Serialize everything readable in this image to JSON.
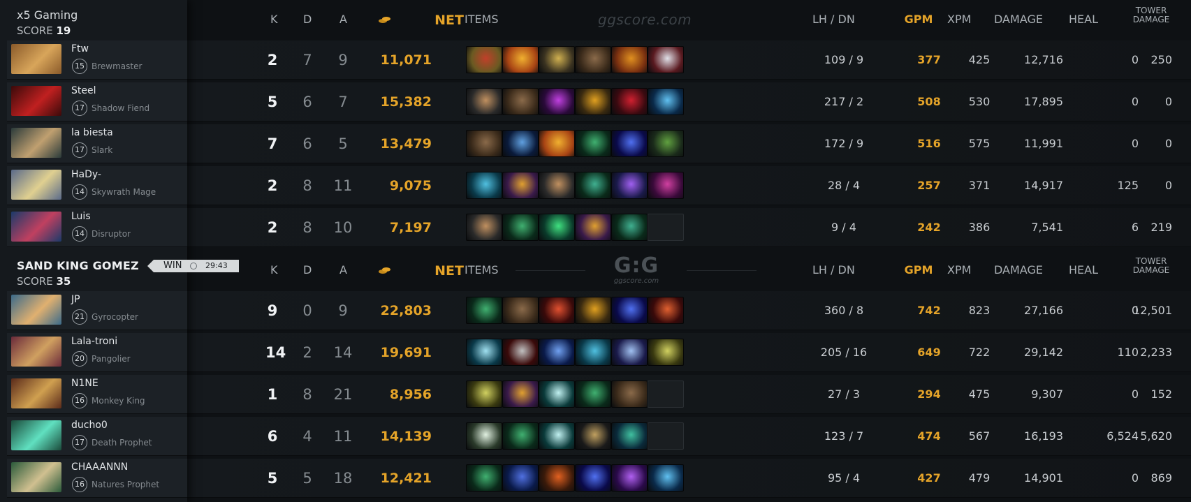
{
  "colors": {
    "gold": "#e5a429",
    "bg": "#0e1114",
    "sidebar": "#15191d"
  },
  "watermark": "ggscore.com",
  "logo": {
    "mark": "G:G",
    "domain": "ggscore.com"
  },
  "headers": {
    "k": "K",
    "d": "D",
    "a": "A",
    "net": "NET",
    "items": "ITEMS",
    "lhdn": "LH  /  DN",
    "gpm": "GPM",
    "xpm": "XPM",
    "damage": "DAMAGE",
    "heal": "HEAL",
    "tower_line1": "TOWER",
    "tower_line2": "DAMAGE"
  },
  "result": {
    "label": "WIN",
    "time": "29:43",
    "icon": "clock-icon"
  },
  "teams": [
    {
      "name": "x5 Gaming",
      "score_label": "SCORE",
      "score": "19",
      "players": [
        {
          "name": "Ftw",
          "level": "15",
          "hero": "Brewmaster",
          "k": "2",
          "d": "7",
          "a": "9",
          "net": "11,071",
          "lhdn": "109  /  9",
          "gpm": "377",
          "xpm": "425",
          "damage": "12,716",
          "heal": "0",
          "tower": "250",
          "avatar": [
            "#8a5a2a",
            "#d8a55a"
          ],
          "items": [
            [
              "#6a5a22",
              "#c0402a"
            ],
            [
              "#a84414",
              "#f0b030"
            ],
            [
              "#3a3220",
              "#d0b050"
            ],
            [
              "#3a2a1a",
              "#8a6a4a"
            ],
            [
              "#7a3010",
              "#e09020"
            ],
            [
              "#5a1a20",
              "#e0e0e8"
            ]
          ]
        },
        {
          "name": "Steel",
          "level": "17",
          "hero": "Shadow Fiend",
          "k": "5",
          "d": "6",
          "a": "7",
          "net": "15,382",
          "lhdn": "217  /  2",
          "gpm": "508",
          "xpm": "530",
          "damage": "17,895",
          "heal": "0",
          "tower": "0",
          "avatar": [
            "#3a0a0a",
            "#c02020"
          ],
          "items": [
            [
              "#2a2a2a",
              "#c09060"
            ],
            [
              "#3a2a1a",
              "#8a6a4a"
            ],
            [
              "#2a0a3a",
              "#c040e0"
            ],
            [
              "#3a2a10",
              "#e0a020"
            ],
            [
              "#3a0a10",
              "#d02030"
            ],
            [
              "#0a2a4a",
              "#60c0f0"
            ]
          ]
        },
        {
          "name": "la biesta",
          "level": "17",
          "hero": "Slark",
          "k": "7",
          "d": "6",
          "a": "5",
          "net": "13,479",
          "lhdn": "172  /  9",
          "gpm": "516",
          "xpm": "575",
          "damage": "11,991",
          "heal": "0",
          "tower": "0",
          "avatar": [
            "#2a3a3a",
            "#c0a070"
          ],
          "items": [
            [
              "#3a2a1a",
              "#8a6a4a"
            ],
            [
              "#0a1a3a",
              "#60a0e0"
            ],
            [
              "#a84414",
              "#f0b030"
            ],
            [
              "#0a2a1a",
              "#40b070"
            ],
            [
              "#0a0a4a",
              "#5070f0"
            ],
            [
              "#1a2a1a",
              "#60a040"
            ]
          ]
        },
        {
          "name": "HaDy-",
          "level": "14",
          "hero": "Skywrath Mage",
          "k": "2",
          "d": "8",
          "a": "11",
          "net": "9,075",
          "lhdn": "28  /  4",
          "gpm": "257",
          "xpm": "371",
          "damage": "14,917",
          "heal": "125",
          "tower": "0",
          "avatar": [
            "#5a6a8a",
            "#e0d090"
          ],
          "items": [
            [
              "#0a3a4a",
              "#50c0e0"
            ],
            [
              "#3a1a4a",
              "#e0a030"
            ],
            [
              "#2a2a2a",
              "#c09060"
            ],
            [
              "#0a2a1a",
              "#40b090"
            ],
            [
              "#1a1a4a",
              "#a060f0"
            ],
            [
              "#3a0a3a",
              "#d040a0"
            ]
          ]
        },
        {
          "name": "Luis",
          "level": "14",
          "hero": "Disruptor",
          "k": "2",
          "d": "8",
          "a": "10",
          "net": "7,197",
          "lhdn": "9  /  4",
          "gpm": "242",
          "xpm": "386",
          "damage": "7,541",
          "heal": "6",
          "tower": "219",
          "avatar": [
            "#1a3a6a",
            "#c04060"
          ],
          "items": [
            [
              "#2a2a2a",
              "#c09060"
            ],
            [
              "#0a2a1a",
              "#40b070"
            ],
            [
              "#0a3a2a",
              "#40e080"
            ],
            [
              "#3a1a4a",
              "#e0a030"
            ],
            [
              "#0a2a1a",
              "#40b090"
            ],
            null
          ]
        }
      ]
    },
    {
      "name": "SAND KING GOMEZ",
      "score_label": "SCORE",
      "score": "35",
      "players": [
        {
          "name": "JP",
          "level": "21",
          "hero": "Gyrocopter",
          "k": "9",
          "d": "0",
          "a": "9",
          "net": "22,803",
          "lhdn": "360  /  8",
          "gpm": "742",
          "xpm": "823",
          "damage": "27,166",
          "heal": "0",
          "tower": "12,501",
          "avatar": [
            "#3a6a8a",
            "#e0b070"
          ],
          "items": [
            [
              "#0a2a1a",
              "#40b070"
            ],
            [
              "#3a2a1a",
              "#8a6a4a"
            ],
            [
              "#3a0a0a",
              "#e05030"
            ],
            [
              "#3a2a10",
              "#e0a020"
            ],
            [
              "#0a0a4a",
              "#5070f0"
            ],
            [
              "#3a0a0a",
              "#e06030"
            ]
          ]
        },
        {
          "name": "Lala-troni",
          "level": "20",
          "hero": "Pangolier",
          "k": "14",
          "d": "2",
          "a": "14",
          "net": "19,691",
          "lhdn": "205  /  16",
          "gpm": "649",
          "xpm": "722",
          "damage": "29,142",
          "heal": "110",
          "tower": "2,233",
          "avatar": [
            "#6a2a3a",
            "#d0a060"
          ],
          "items": [
            [
              "#0a3a4a",
              "#a0e0f0"
            ],
            [
              "#3a0a0a",
              "#c0c0c0"
            ],
            [
              "#0a1a4a",
              "#70a0f0"
            ],
            [
              "#0a3a4a",
              "#50c0e0"
            ],
            [
              "#1a1a4a",
              "#a0c0f0"
            ],
            [
              "#3a3a10",
              "#d0d060"
            ]
          ]
        },
        {
          "name": "N1NE",
          "level": "16",
          "hero": "Monkey King",
          "k": "1",
          "d": "8",
          "a": "21",
          "net": "8,956",
          "lhdn": "27  /  3",
          "gpm": "294",
          "xpm": "475",
          "damage": "9,307",
          "heal": "0",
          "tower": "152",
          "avatar": [
            "#5a2a1a",
            "#d0a050"
          ],
          "items": [
            [
              "#3a3a10",
              "#d0d060"
            ],
            [
              "#3a1a4a",
              "#e0a030"
            ],
            [
              "#0a3a3a",
              "#c0f0f0"
            ],
            [
              "#0a2a1a",
              "#40b070"
            ],
            [
              "#3a2a1a",
              "#8a6a4a"
            ],
            null
          ]
        },
        {
          "name": "ducho0",
          "level": "17",
          "hero": "Death Prophet",
          "k": "6",
          "d": "4",
          "a": "11",
          "net": "14,139",
          "lhdn": "123  /  7",
          "gpm": "474",
          "xpm": "567",
          "damage": "16,193",
          "heal": "6,524",
          "tower": "5,620",
          "avatar": [
            "#1a4a3a",
            "#60e0c0"
          ],
          "items": [
            [
              "#2a3a2a",
              "#e0f0e0"
            ],
            [
              "#0a2a1a",
              "#40b070"
            ],
            [
              "#0a3a3a",
              "#c0f0f0"
            ],
            [
              "#1a1a1a",
              "#c0a060"
            ],
            [
              "#0a2a3a",
              "#40c0a0"
            ],
            null
          ]
        },
        {
          "name": "CHAAANNN",
          "level": "16",
          "hero": "Natures Prophet",
          "k": "5",
          "d": "5",
          "a": "18",
          "net": "12,421",
          "lhdn": "95  /  4",
          "gpm": "427",
          "xpm": "479",
          "damage": "14,901",
          "heal": "0",
          "tower": "869",
          "avatar": [
            "#2a5a3a",
            "#d0c090"
          ],
          "items": [
            [
              "#0a2a1a",
              "#40b070"
            ],
            [
              "#0a1a4a",
              "#5070e0"
            ],
            [
              "#3a1a0a",
              "#e06020"
            ],
            [
              "#0a0a4a",
              "#5070f0"
            ],
            [
              "#2a0a4a",
              "#b060f0"
            ],
            [
              "#0a2a4a",
              "#60c0f0"
            ]
          ]
        }
      ]
    }
  ]
}
